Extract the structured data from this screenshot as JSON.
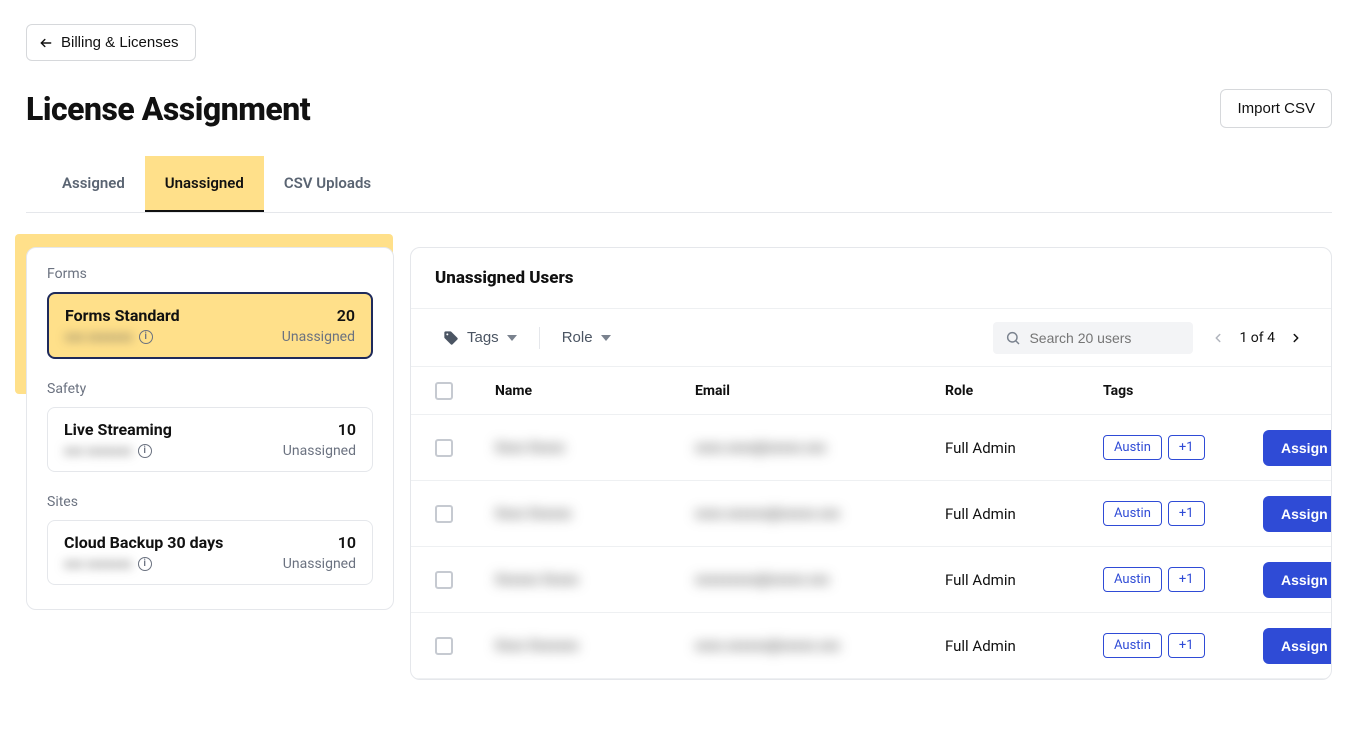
{
  "back_link_label": "Billing & Licenses",
  "page_title": "License Assignment",
  "import_csv_label": "Import CSV",
  "tabs": [
    {
      "label": "Assigned",
      "active": false
    },
    {
      "label": "Unassigned",
      "active": true
    },
    {
      "label": "CSV Uploads",
      "active": false
    }
  ],
  "sidebar": {
    "groups": [
      {
        "label": "Forms",
        "items": [
          {
            "name": "Forms Standard",
            "count": "20",
            "sub_label": "Unassigned",
            "sub_blur": "xxx xxxxxxx",
            "selected": true
          }
        ]
      },
      {
        "label": "Safety",
        "items": [
          {
            "name": "Live Streaming",
            "count": "10",
            "sub_label": "Unassigned",
            "sub_blur": "xxx xxxxxxx",
            "selected": false
          }
        ]
      },
      {
        "label": "Sites",
        "items": [
          {
            "name": "Cloud Backup 30 days",
            "count": "10",
            "sub_label": "Unassigned",
            "sub_blur": "xxx xxxxxxx",
            "selected": false
          }
        ]
      }
    ]
  },
  "main": {
    "title": "Unassigned Users",
    "filters": {
      "tags_label": "Tags",
      "role_label": "Role"
    },
    "search_placeholder": "Search 20 users",
    "pager_text": "1 of 4",
    "columns": {
      "name": "Name",
      "email": "Email",
      "role": "Role",
      "tags": "Tags"
    },
    "rows": [
      {
        "name_blur": "Xxxx Xxxxx",
        "email_blur": "xxxx.xxxx@xxxxx.xxx",
        "role": "Full Admin",
        "tag": "Austin",
        "extra_tag": "+1",
        "assign_label": "Assign"
      },
      {
        "name_blur": "Xxxx Xxxxxx",
        "email_blur": "xxxx.xxxxxx@xxxxx.xxx",
        "role": "Full Admin",
        "tag": "Austin",
        "extra_tag": "+1",
        "assign_label": "Assign"
      },
      {
        "name_blur": "Xxxxxx Xxxxx",
        "email_blur": "xxxxxxxxx@xxxxx.xxx",
        "role": "Full Admin",
        "tag": "Austin",
        "extra_tag": "+1",
        "assign_label": "Assign"
      },
      {
        "name_blur": "Xxxx Xxxxxxx",
        "email_blur": "xxxx.xxxxxx@xxxxx.xxx",
        "role": "Full Admin",
        "tag": "Austin",
        "extra_tag": "+1",
        "assign_label": "Assign"
      }
    ]
  }
}
